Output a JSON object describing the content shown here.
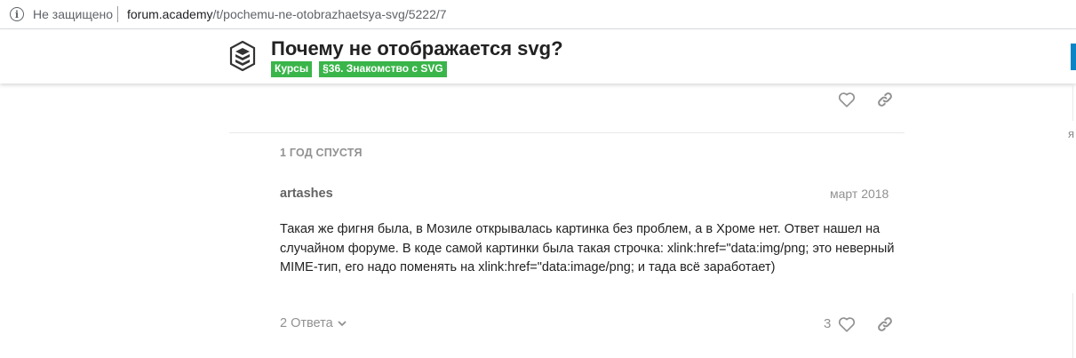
{
  "browser": {
    "security_label": "Не защищено",
    "url_host": "forum.academy",
    "url_path": "/t/pochemu-ne-otobrazhaetsya-svg/5222/7"
  },
  "header": {
    "title": "Почему не отображается svg?",
    "categories": [
      "Курсы",
      "§36. Знакомство с SVG"
    ],
    "category_color": "#3ab54a"
  },
  "side": {
    "partial_letter": "я"
  },
  "post": {
    "time_gap": "1 ГОД СПУСТЯ",
    "username": "artashes",
    "date": "март 2018",
    "body": "Такая же фигня была, в Мозиле открывалась картинка без проблем, а в Хроме нет. Ответ нашел на случайном форуме. В коде самой картинки была такая строчка: xlink:href=\"data:img/png; это неверный MIME-тип, его надо поменять на xlink:href=\"data:image/png; и тада всё заработает)",
    "replies_label": "2 Ответа",
    "like_count": "3"
  },
  "icons": {
    "info": "info-icon",
    "logo": "academy-logo",
    "like": "heart-icon",
    "share": "link-icon",
    "expand": "chevron-down-icon"
  }
}
